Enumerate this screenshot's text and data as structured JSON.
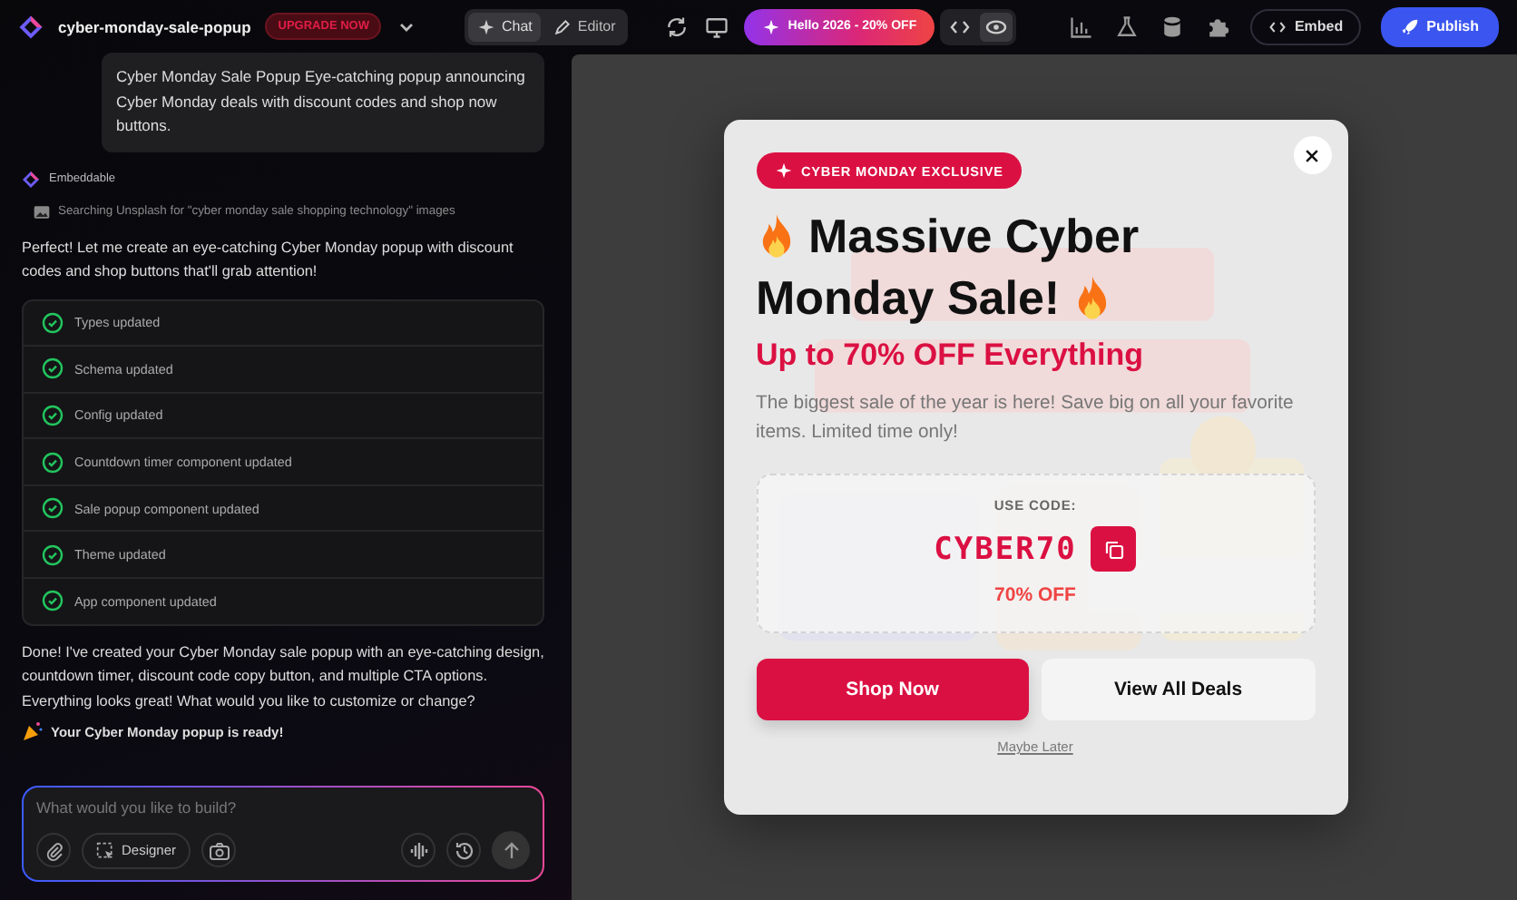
{
  "header": {
    "project": "cyber-monday-sale-popup",
    "upgrade": "UPGRADE NOW",
    "mode_tabs": [
      {
        "label": "Chat",
        "kind": "chat",
        "selected": true
      },
      {
        "label": "Editor",
        "kind": "editor",
        "selected": false
      }
    ],
    "promo": "Hello 2026 - 20% OFF",
    "view_toggle": [
      {
        "kind": "code",
        "selected": false
      },
      {
        "kind": "preview",
        "selected": true
      }
    ],
    "embed": "Embed",
    "publish": "Publish"
  },
  "chat": {
    "user_message": "Cyber Monday Sale Popup Eye-catching popup announcing Cyber Monday deals with discount codes and shop now buttons.",
    "assistant": "Embeddable",
    "search_status": "Searching Unsplash for \"cyber monday sale shopping technology\" images",
    "intro": "Perfect! Let me create an eye-catching Cyber Monday popup with discount codes and shop buttons that'll grab attention!",
    "steps": [
      {
        "label": "Types updated",
        "done": true
      },
      {
        "label": "Schema updated",
        "done": true
      },
      {
        "label": "Config updated",
        "done": true
      },
      {
        "label": "Countdown timer component updated",
        "done": true
      },
      {
        "label": "Sale popup component updated",
        "done": true
      },
      {
        "label": "Theme updated",
        "done": true
      },
      {
        "label": "App component updated",
        "done": true
      }
    ],
    "summary": "Done! I've created your Cyber Monday sale popup with an eye-catching design, countdown timer, discount code copy button, and multiple CTA options. Everything looks great! What would you like to customize or change?",
    "ready": "Your Cyber Monday popup is ready!"
  },
  "composer": {
    "placeholder": "What would you like to build?",
    "designer": "Designer"
  },
  "popup": {
    "badge": "CYBER MONDAY EXCLUSIVE",
    "title_lines": [
      "Massive Cyber",
      "Monday Sale!"
    ],
    "subtitle": "Up to 70% OFF Everything",
    "description": "The biggest sale of the year is here! Save big on all your favorite items. Limited time only!",
    "code_label": "USE CODE:",
    "code": "CYBER70",
    "discount": "70% OFF",
    "primary": "Shop Now",
    "secondary": "View All Deals",
    "dismiss": "Maybe Later"
  }
}
